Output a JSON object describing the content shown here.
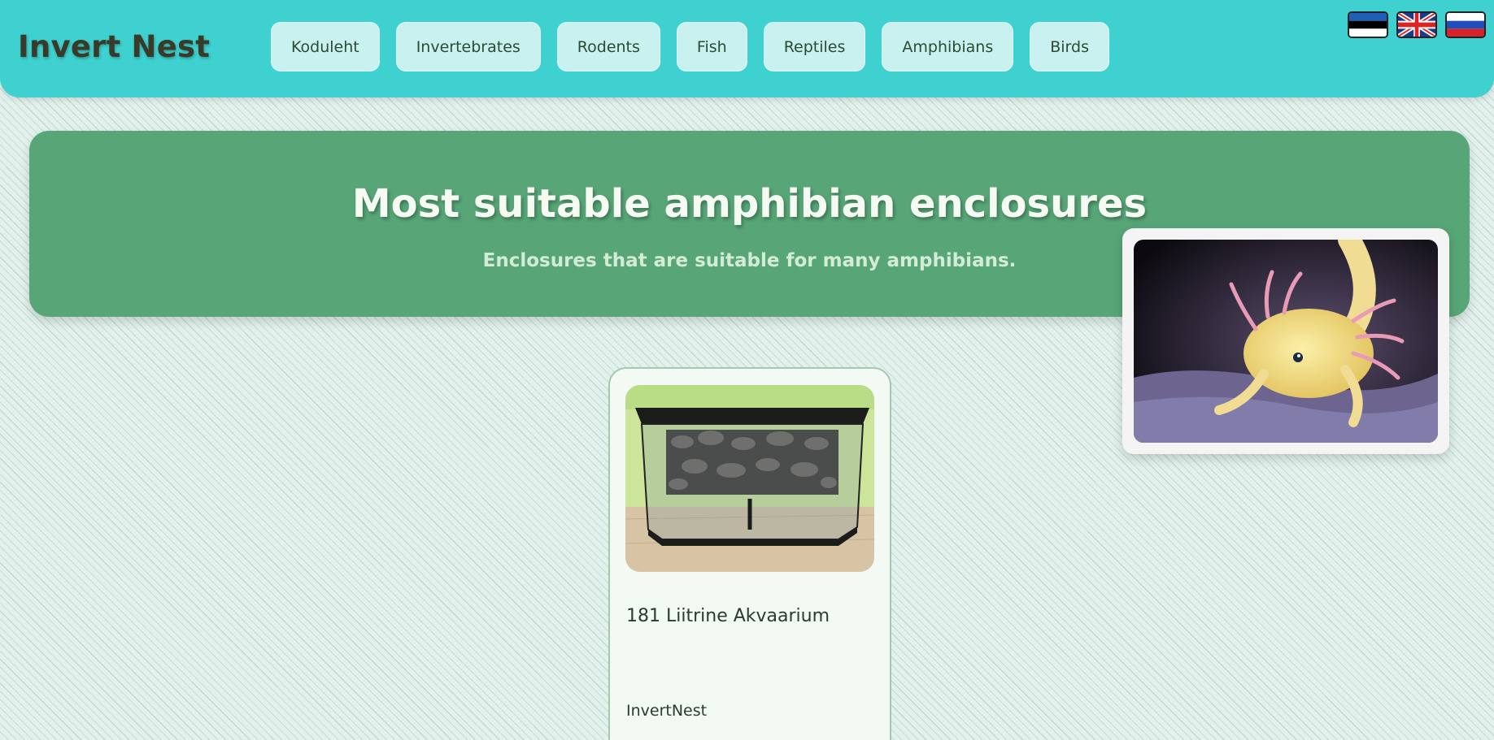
{
  "header": {
    "logo": "Invert Nest",
    "nav": [
      "Koduleht",
      "Invertebrates",
      "Rodents",
      "Fish",
      "Reptiles",
      "Amphibians",
      "Birds"
    ],
    "languages": [
      {
        "icon": "estonia-flag-icon"
      },
      {
        "icon": "uk-flag-icon"
      },
      {
        "icon": "russia-flag-icon"
      }
    ]
  },
  "hero": {
    "title": "Most suitable amphibian enclosures",
    "subtitle": "Enclosures that are suitable for many amphibians.",
    "image_icon": "axolotl-photo"
  },
  "products": [
    {
      "title": "181 Liitrine Akvaarium",
      "vendor": "InvertNest",
      "image_icon": "aquarium-photo"
    }
  ],
  "colors": {
    "header_bg": "#3ed1cf",
    "nav_button_bg": "#c8f1f0",
    "hero_bg": "#58a678",
    "card_bg": "#f3f9f3"
  }
}
